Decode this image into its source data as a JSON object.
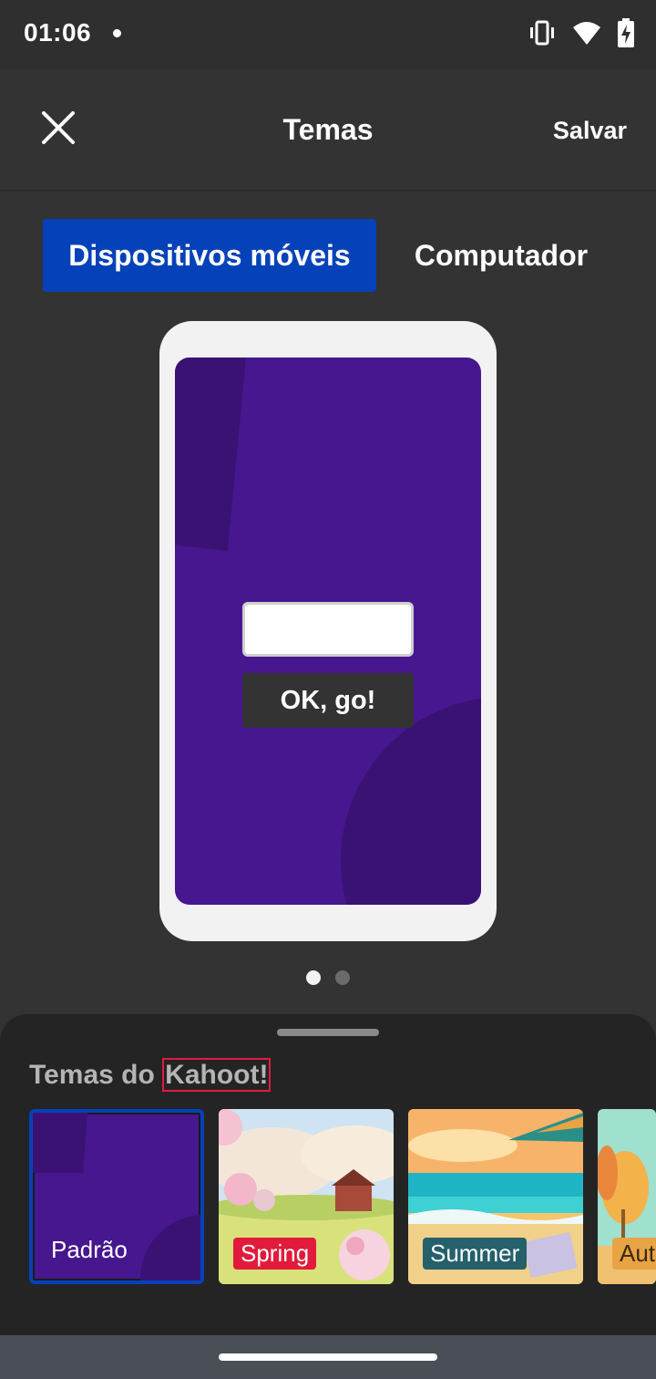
{
  "status_bar": {
    "time": "01:06",
    "icons": [
      "vibrate-icon",
      "wifi-icon",
      "battery-charging-icon"
    ]
  },
  "app_bar": {
    "title": "Temas",
    "save_label": "Salvar",
    "close_icon": "close-icon"
  },
  "segments": [
    {
      "label": "Dispositivos móveis",
      "selected": true
    },
    {
      "label": "Computador",
      "selected": false
    }
  ],
  "preview": {
    "go_button_label": "OK, go!",
    "page_count": 2,
    "current_page": 1
  },
  "theme_sheet": {
    "title_prefix": "Temas do ",
    "title_brand": "Kahoot!",
    "themes": [
      {
        "label": "Padrão",
        "selected": true
      },
      {
        "label": "Spring",
        "selected": false
      },
      {
        "label": "Summer",
        "selected": false
      },
      {
        "label": "Aut",
        "selected": false
      }
    ]
  },
  "colors": {
    "accent": "#0542b9",
    "kahoot_purple": "#46178f",
    "spring_red": "#e21b3c",
    "summer_teal": "#25606b"
  }
}
